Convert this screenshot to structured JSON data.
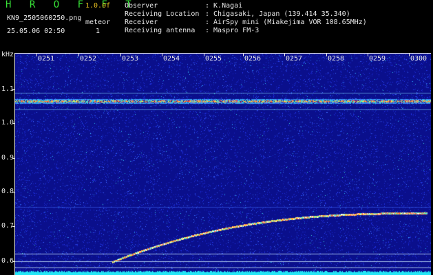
{
  "header": {
    "app_title": "H R O F F T",
    "version": "1.0.0f",
    "filename": "KN9_2505060250.png",
    "datetime": "25.05.06 02:50",
    "meteor_label": "meteor",
    "meteor_count": "1"
  },
  "meta": [
    {
      "key": "Observer",
      "value": ": K.Nagai"
    },
    {
      "key": "Receiving Location",
      "value": ": Chigasaki, Japan (139.414 35.340)"
    },
    {
      "key": "Receiver",
      "value": ": AirSpy mini (Miakejima VOR 108.65MHz)"
    },
    {
      "key": "Receiving antenna",
      "value": ": Maspro FM-3"
    }
  ],
  "axis": {
    "y_unit": "kHz",
    "time_ticks": [
      "0251",
      "0252",
      "0253",
      "0254",
      "0255",
      "0256",
      "0257",
      "0258",
      "0259",
      "0300"
    ],
    "freq_ticks": [
      "1.1",
      "1.0",
      "0.9",
      "0.8",
      "0.7",
      "0.6"
    ]
  },
  "colors": {
    "background": "#000000",
    "plot_bg": "#0a0f8c",
    "title_green": "#37e037",
    "version_yellow": "#e8c020",
    "text": "#e8e8e8",
    "baseline_cyan": "#23e6f5"
  }
}
